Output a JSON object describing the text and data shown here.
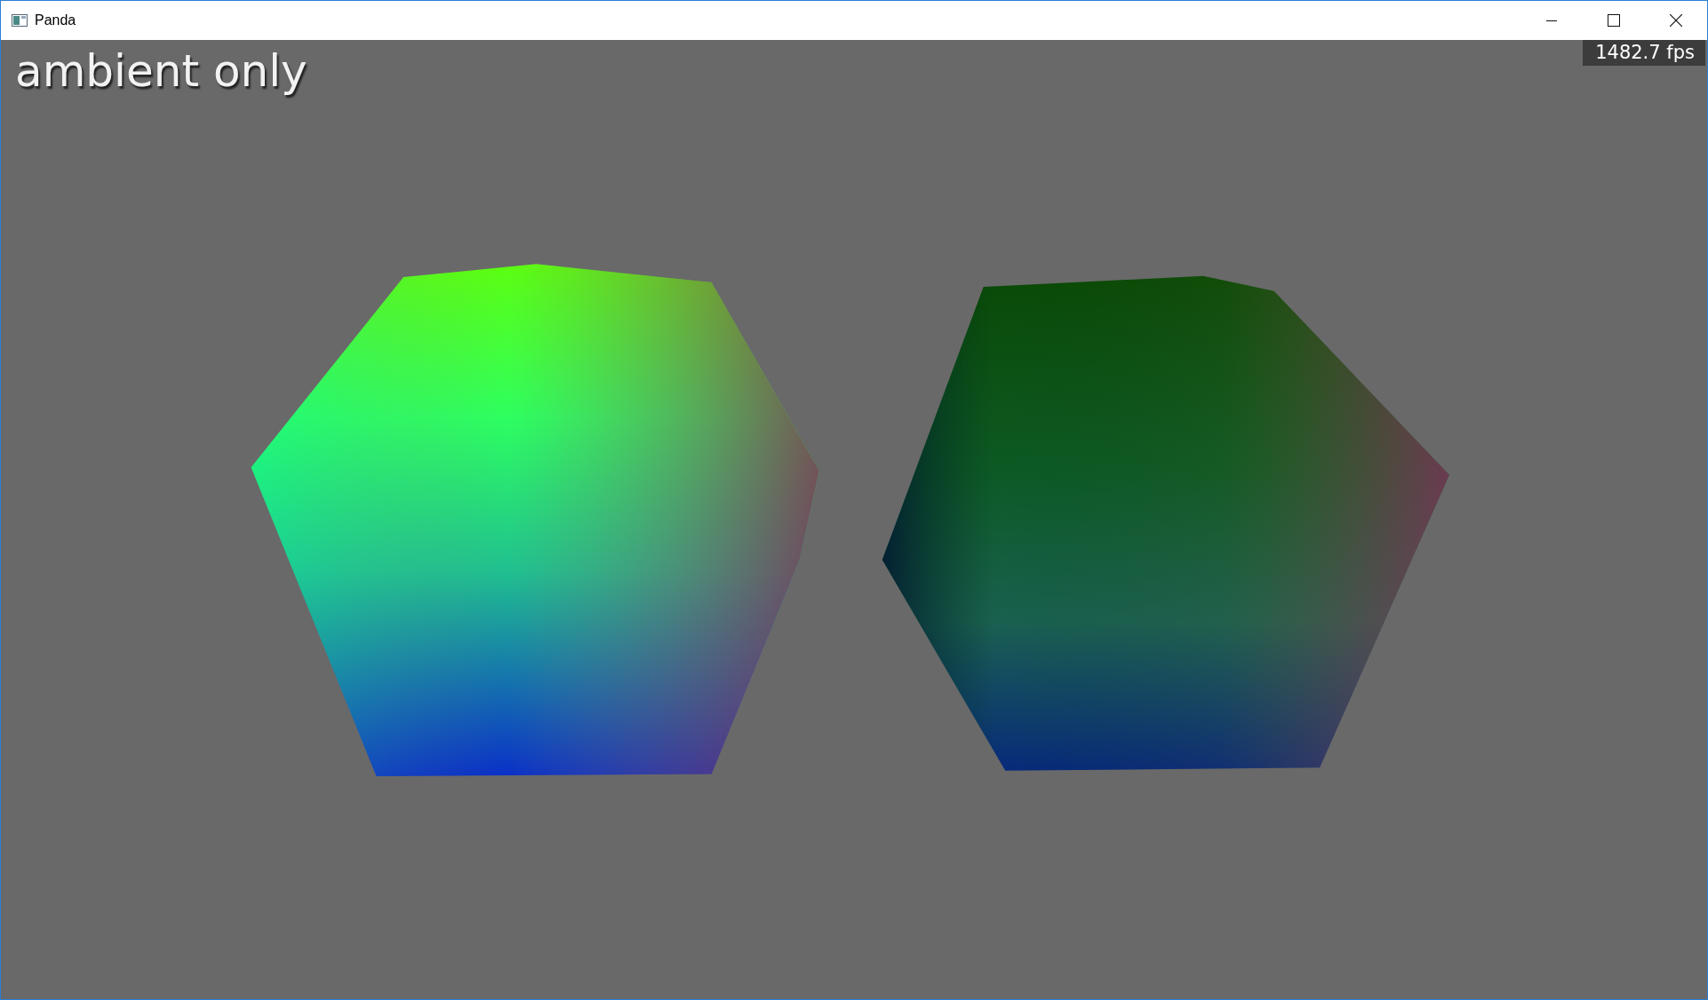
{
  "window": {
    "title": "Panda"
  },
  "viewport": {
    "caption": "ambient only",
    "frame_rate": "1482.7 fps"
  }
}
